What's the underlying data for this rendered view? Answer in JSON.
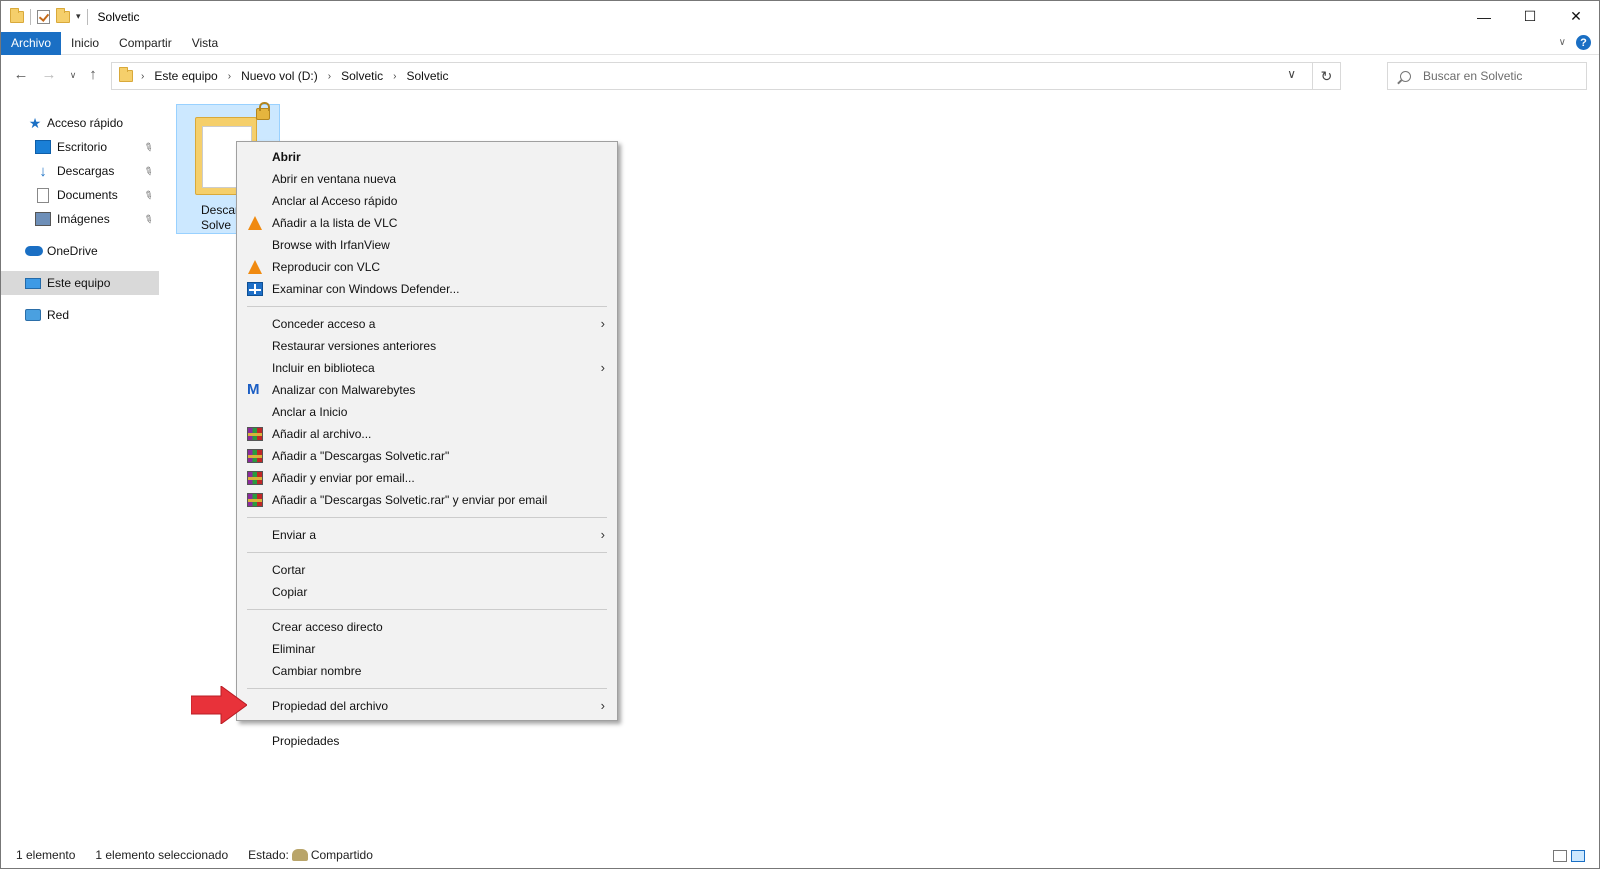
{
  "window": {
    "title": "Solvetic",
    "controls": {
      "minimize": "—",
      "maximize": "☐",
      "close": "✕"
    }
  },
  "ribbon": {
    "tabs": [
      "Archivo",
      "Inicio",
      "Compartir",
      "Vista"
    ],
    "active_tab": "Archivo",
    "help": "?"
  },
  "address": {
    "crumbs": [
      "Este equipo",
      "Nuevo vol (D:)",
      "Solvetic",
      "Solvetic"
    ],
    "search_placeholder": "Buscar en Solvetic"
  },
  "nav": {
    "quick_access": "Acceso rápido",
    "items": [
      {
        "label": "Escritorio",
        "icon": "desktop-icon",
        "pinned": true
      },
      {
        "label": "Descargas",
        "icon": "downloads-icon",
        "pinned": true
      },
      {
        "label": "Documents",
        "icon": "documents-icon",
        "pinned": true
      },
      {
        "label": "Imágenes",
        "icon": "pictures-icon",
        "pinned": true
      }
    ],
    "onedrive": "OneDrive",
    "this_pc": "Este equipo",
    "network": "Red"
  },
  "file": {
    "name_line1": "Descar",
    "name_line2": "Solve"
  },
  "context_menu": {
    "group1": [
      {
        "label": "Abrir",
        "icon": "",
        "bold": true
      },
      {
        "label": "Abrir en ventana nueva",
        "icon": ""
      },
      {
        "label": "Anclar al Acceso rápido",
        "icon": ""
      },
      {
        "label": "Añadir a la lista de VLC",
        "icon": "vlc-icon"
      },
      {
        "label": "Browse with IrfanView",
        "icon": ""
      },
      {
        "label": "Reproducir con VLC",
        "icon": "vlc-icon"
      },
      {
        "label": "Examinar con Windows Defender...",
        "icon": "defender-icon"
      }
    ],
    "group2": [
      {
        "label": "Conceder acceso a",
        "icon": "",
        "submenu": true
      },
      {
        "label": "Restaurar versiones anteriores",
        "icon": ""
      },
      {
        "label": "Incluir en biblioteca",
        "icon": "",
        "submenu": true
      },
      {
        "label": "Analizar con Malwarebytes",
        "icon": "malwarebytes-icon"
      },
      {
        "label": "Anclar a Inicio",
        "icon": ""
      },
      {
        "label": "Añadir al archivo...",
        "icon": "winrar-icon"
      },
      {
        "label": "Añadir a \"Descargas Solvetic.rar\"",
        "icon": "winrar-icon"
      },
      {
        "label": "Añadir y enviar por email...",
        "icon": "winrar-icon"
      },
      {
        "label": "Añadir a \"Descargas Solvetic.rar\" y enviar por email",
        "icon": "winrar-icon"
      }
    ],
    "group3": [
      {
        "label": "Enviar a",
        "icon": "",
        "submenu": true
      }
    ],
    "group4": [
      {
        "label": "Cortar",
        "icon": ""
      },
      {
        "label": "Copiar",
        "icon": ""
      }
    ],
    "group5": [
      {
        "label": "Crear acceso directo",
        "icon": ""
      },
      {
        "label": "Eliminar",
        "icon": ""
      },
      {
        "label": "Cambiar nombre",
        "icon": ""
      }
    ],
    "group6": [
      {
        "label": "Propiedad del archivo",
        "icon": "",
        "submenu": true
      }
    ],
    "group7": [
      {
        "label": "Propiedades",
        "icon": "",
        "highlighted": true
      }
    ],
    "submenu_glyph": "›"
  },
  "status": {
    "count": "1 elemento",
    "selected": "1 elemento seleccionado",
    "state_label": "Estado:",
    "state_value": "Compartido"
  },
  "colors": {
    "accent": "#1a6fc4",
    "selection": "#cce8ff",
    "menu_bg": "#f2f2f2",
    "arrow": "#e8323a"
  }
}
